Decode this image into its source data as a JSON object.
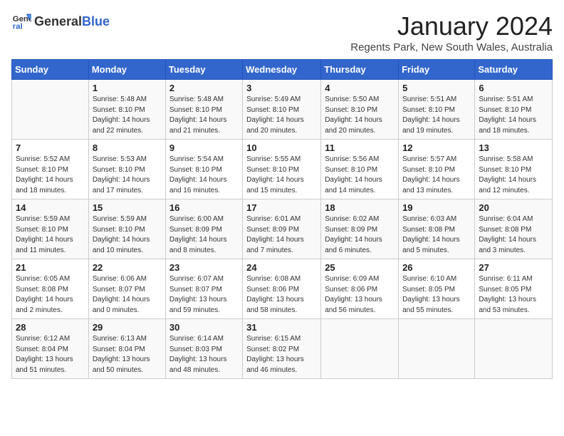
{
  "header": {
    "logo_general": "General",
    "logo_blue": "Blue",
    "title": "January 2024",
    "location": "Regents Park, New South Wales, Australia"
  },
  "days_of_week": [
    "Sunday",
    "Monday",
    "Tuesday",
    "Wednesday",
    "Thursday",
    "Friday",
    "Saturday"
  ],
  "weeks": [
    [
      {
        "day": "",
        "sunrise": "",
        "sunset": "",
        "daylight": ""
      },
      {
        "day": "1",
        "sunrise": "Sunrise: 5:48 AM",
        "sunset": "Sunset: 8:10 PM",
        "daylight": "Daylight: 14 hours and 22 minutes."
      },
      {
        "day": "2",
        "sunrise": "Sunrise: 5:48 AM",
        "sunset": "Sunset: 8:10 PM",
        "daylight": "Daylight: 14 hours and 21 minutes."
      },
      {
        "day": "3",
        "sunrise": "Sunrise: 5:49 AM",
        "sunset": "Sunset: 8:10 PM",
        "daylight": "Daylight: 14 hours and 20 minutes."
      },
      {
        "day": "4",
        "sunrise": "Sunrise: 5:50 AM",
        "sunset": "Sunset: 8:10 PM",
        "daylight": "Daylight: 14 hours and 20 minutes."
      },
      {
        "day": "5",
        "sunrise": "Sunrise: 5:51 AM",
        "sunset": "Sunset: 8:10 PM",
        "daylight": "Daylight: 14 hours and 19 minutes."
      },
      {
        "day": "6",
        "sunrise": "Sunrise: 5:51 AM",
        "sunset": "Sunset: 8:10 PM",
        "daylight": "Daylight: 14 hours and 18 minutes."
      }
    ],
    [
      {
        "day": "7",
        "sunrise": "Sunrise: 5:52 AM",
        "sunset": "Sunset: 8:10 PM",
        "daylight": "Daylight: 14 hours and 18 minutes."
      },
      {
        "day": "8",
        "sunrise": "Sunrise: 5:53 AM",
        "sunset": "Sunset: 8:10 PM",
        "daylight": "Daylight: 14 hours and 17 minutes."
      },
      {
        "day": "9",
        "sunrise": "Sunrise: 5:54 AM",
        "sunset": "Sunset: 8:10 PM",
        "daylight": "Daylight: 14 hours and 16 minutes."
      },
      {
        "day": "10",
        "sunrise": "Sunrise: 5:55 AM",
        "sunset": "Sunset: 8:10 PM",
        "daylight": "Daylight: 14 hours and 15 minutes."
      },
      {
        "day": "11",
        "sunrise": "Sunrise: 5:56 AM",
        "sunset": "Sunset: 8:10 PM",
        "daylight": "Daylight: 14 hours and 14 minutes."
      },
      {
        "day": "12",
        "sunrise": "Sunrise: 5:57 AM",
        "sunset": "Sunset: 8:10 PM",
        "daylight": "Daylight: 14 hours and 13 minutes."
      },
      {
        "day": "13",
        "sunrise": "Sunrise: 5:58 AM",
        "sunset": "Sunset: 8:10 PM",
        "daylight": "Daylight: 14 hours and 12 minutes."
      }
    ],
    [
      {
        "day": "14",
        "sunrise": "Sunrise: 5:59 AM",
        "sunset": "Sunset: 8:10 PM",
        "daylight": "Daylight: 14 hours and 11 minutes."
      },
      {
        "day": "15",
        "sunrise": "Sunrise: 5:59 AM",
        "sunset": "Sunset: 8:10 PM",
        "daylight": "Daylight: 14 hours and 10 minutes."
      },
      {
        "day": "16",
        "sunrise": "Sunrise: 6:00 AM",
        "sunset": "Sunset: 8:09 PM",
        "daylight": "Daylight: 14 hours and 8 minutes."
      },
      {
        "day": "17",
        "sunrise": "Sunrise: 6:01 AM",
        "sunset": "Sunset: 8:09 PM",
        "daylight": "Daylight: 14 hours and 7 minutes."
      },
      {
        "day": "18",
        "sunrise": "Sunrise: 6:02 AM",
        "sunset": "Sunset: 8:09 PM",
        "daylight": "Daylight: 14 hours and 6 minutes."
      },
      {
        "day": "19",
        "sunrise": "Sunrise: 6:03 AM",
        "sunset": "Sunset: 8:08 PM",
        "daylight": "Daylight: 14 hours and 5 minutes."
      },
      {
        "day": "20",
        "sunrise": "Sunrise: 6:04 AM",
        "sunset": "Sunset: 8:08 PM",
        "daylight": "Daylight: 14 hours and 3 minutes."
      }
    ],
    [
      {
        "day": "21",
        "sunrise": "Sunrise: 6:05 AM",
        "sunset": "Sunset: 8:08 PM",
        "daylight": "Daylight: 14 hours and 2 minutes."
      },
      {
        "day": "22",
        "sunrise": "Sunrise: 6:06 AM",
        "sunset": "Sunset: 8:07 PM",
        "daylight": "Daylight: 14 hours and 0 minutes."
      },
      {
        "day": "23",
        "sunrise": "Sunrise: 6:07 AM",
        "sunset": "Sunset: 8:07 PM",
        "daylight": "Daylight: 13 hours and 59 minutes."
      },
      {
        "day": "24",
        "sunrise": "Sunrise: 6:08 AM",
        "sunset": "Sunset: 8:06 PM",
        "daylight": "Daylight: 13 hours and 58 minutes."
      },
      {
        "day": "25",
        "sunrise": "Sunrise: 6:09 AM",
        "sunset": "Sunset: 8:06 PM",
        "daylight": "Daylight: 13 hours and 56 minutes."
      },
      {
        "day": "26",
        "sunrise": "Sunrise: 6:10 AM",
        "sunset": "Sunset: 8:05 PM",
        "daylight": "Daylight: 13 hours and 55 minutes."
      },
      {
        "day": "27",
        "sunrise": "Sunrise: 6:11 AM",
        "sunset": "Sunset: 8:05 PM",
        "daylight": "Daylight: 13 hours and 53 minutes."
      }
    ],
    [
      {
        "day": "28",
        "sunrise": "Sunrise: 6:12 AM",
        "sunset": "Sunset: 8:04 PM",
        "daylight": "Daylight: 13 hours and 51 minutes."
      },
      {
        "day": "29",
        "sunrise": "Sunrise: 6:13 AM",
        "sunset": "Sunset: 8:04 PM",
        "daylight": "Daylight: 13 hours and 50 minutes."
      },
      {
        "day": "30",
        "sunrise": "Sunrise: 6:14 AM",
        "sunset": "Sunset: 8:03 PM",
        "daylight": "Daylight: 13 hours and 48 minutes."
      },
      {
        "day": "31",
        "sunrise": "Sunrise: 6:15 AM",
        "sunset": "Sunset: 8:02 PM",
        "daylight": "Daylight: 13 hours and 46 minutes."
      },
      {
        "day": "",
        "sunrise": "",
        "sunset": "",
        "daylight": ""
      },
      {
        "day": "",
        "sunrise": "",
        "sunset": "",
        "daylight": ""
      },
      {
        "day": "",
        "sunrise": "",
        "sunset": "",
        "daylight": ""
      }
    ]
  ]
}
